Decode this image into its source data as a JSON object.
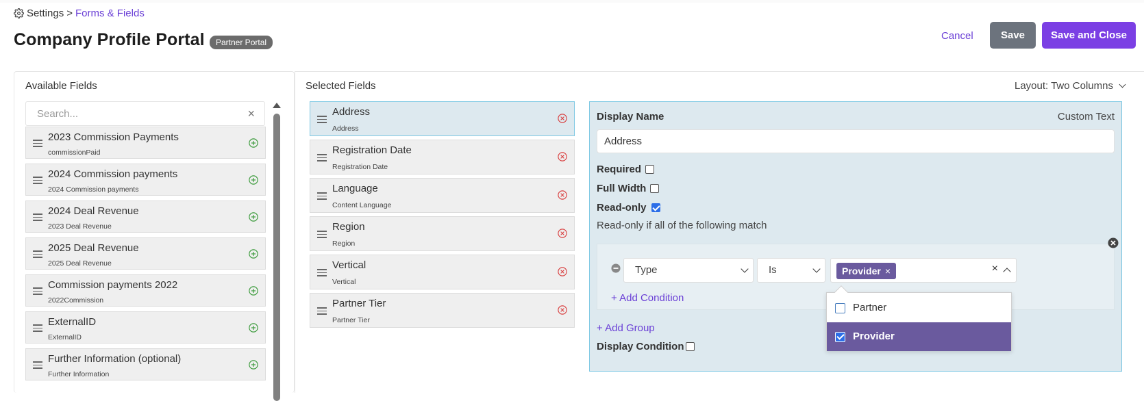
{
  "breadcrumb": {
    "root": "Settings",
    "separator": ">",
    "current": "Forms & Fields"
  },
  "header": {
    "title": "Company Profile Portal",
    "badge": "Partner Portal"
  },
  "actions": {
    "cancel": "Cancel",
    "save": "Save",
    "save_close": "Save and Close"
  },
  "available": {
    "heading": "Available Fields",
    "search_placeholder": "Search...",
    "items": [
      {
        "title": "2023 Commission Payments",
        "sub": "commissionPaid"
      },
      {
        "title": "2024 Commission payments",
        "sub": "2024 Commission payments"
      },
      {
        "title": "2024 Deal Revenue",
        "sub": "2023 Deal Revenue"
      },
      {
        "title": "2025 Deal Revenue",
        "sub": "2025 Deal Revenue"
      },
      {
        "title": "Commission payments 2022",
        "sub": "2022Commission"
      },
      {
        "title": "ExternalID",
        "sub": "ExternalID"
      },
      {
        "title": "Further Information (optional)",
        "sub": "Further Information"
      }
    ]
  },
  "selected": {
    "heading": "Selected Fields",
    "layout_label": "Layout: Two Columns",
    "items": [
      {
        "title": "Address",
        "sub": "Address"
      },
      {
        "title": "Registration Date",
        "sub": "Registration Date"
      },
      {
        "title": "Language",
        "sub": "Content Language"
      },
      {
        "title": "Region",
        "sub": "Region"
      },
      {
        "title": "Vertical",
        "sub": "Vertical"
      },
      {
        "title": "Partner Tier",
        "sub": "Partner Tier"
      }
    ]
  },
  "editor": {
    "display_name_label": "Display Name",
    "custom_text": "Custom Text",
    "display_name_value": "Address",
    "required_label": "Required",
    "full_width_label": "Full Width",
    "read_only_label": "Read-only",
    "read_only_checked": true,
    "read_only_note": "Read-only if all of the following match",
    "condition": {
      "field": "Type",
      "operator": "Is",
      "chip": "Provider",
      "add_condition": "+ Add Condition"
    },
    "add_group": "+ Add Group",
    "display_condition_label": "Display Condition",
    "dropdown_options": [
      {
        "label": "Partner",
        "checked": false
      },
      {
        "label": "Provider",
        "checked": true
      }
    ]
  },
  "colors": {
    "accent": "#7b3fe4",
    "link": "#6a3fd6",
    "chip": "#6a5a9e",
    "panel": "#dde9ef"
  }
}
